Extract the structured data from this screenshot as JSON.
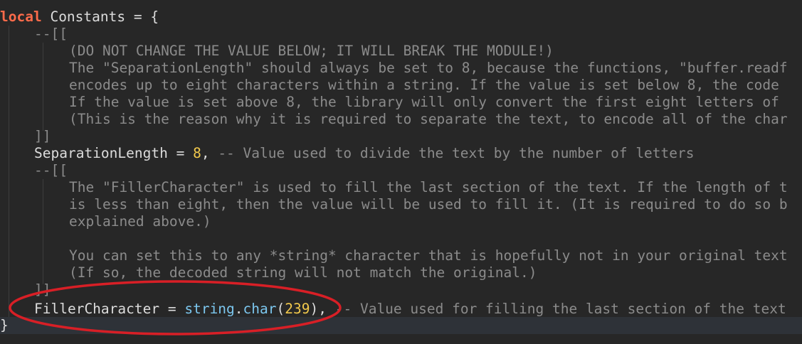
{
  "code": {
    "line1": {
      "keyword": "local",
      "name": "Constants",
      "assign": " = {"
    },
    "line2": "--[[",
    "line3": "(DO NOT CHANGE THE VALUE BELOW; IT WILL BREAK THE MODULE!)",
    "line4": "The \"SeparationLength\" should always be set to 8, because the functions, \"buffer.readf",
    "line5": "encodes up to eight characters within a string. If the value is set below 8, the code",
    "line6": "If the value is set above 8, the library will only convert the first eight letters of",
    "line7": "(This is the reason why it is required to separate the text, to encode all of the char",
    "line8": "]]",
    "line9": {
      "name": "SeparationLength",
      "assign": " = ",
      "value": "8",
      "comma": ",",
      "comment": " -- Value used to divide the text by the number of letters"
    },
    "line10": "--[[",
    "line11": "The \"FillerCharacter\" is used to fill the last section of the text. If the length of t",
    "line12": "is less than eight, then the value will be used to fill it. (It is required to do so b",
    "line13": "explained above.)",
    "line15": "You can set this to any *string* character that is hopefully not in your original text",
    "line16": "(If so, the decoded string will not match the original.)",
    "line17": "]]",
    "line18": {
      "name": "FillerCharacter",
      "assign": " = ",
      "lib": "string",
      "dot": ".",
      "fn": "char",
      "open": "(",
      "value": "239",
      "close": ")",
      "comma": ",",
      "comment": " -- Value used for filling the last section of the text"
    },
    "line19": "}"
  },
  "colors": {
    "background": "#272727",
    "keyword": "#ff6b4a",
    "number": "#f2c94c",
    "comment": "#8b8b8b",
    "builtin": "#7cc7ef",
    "annotation": "#d81f26"
  }
}
